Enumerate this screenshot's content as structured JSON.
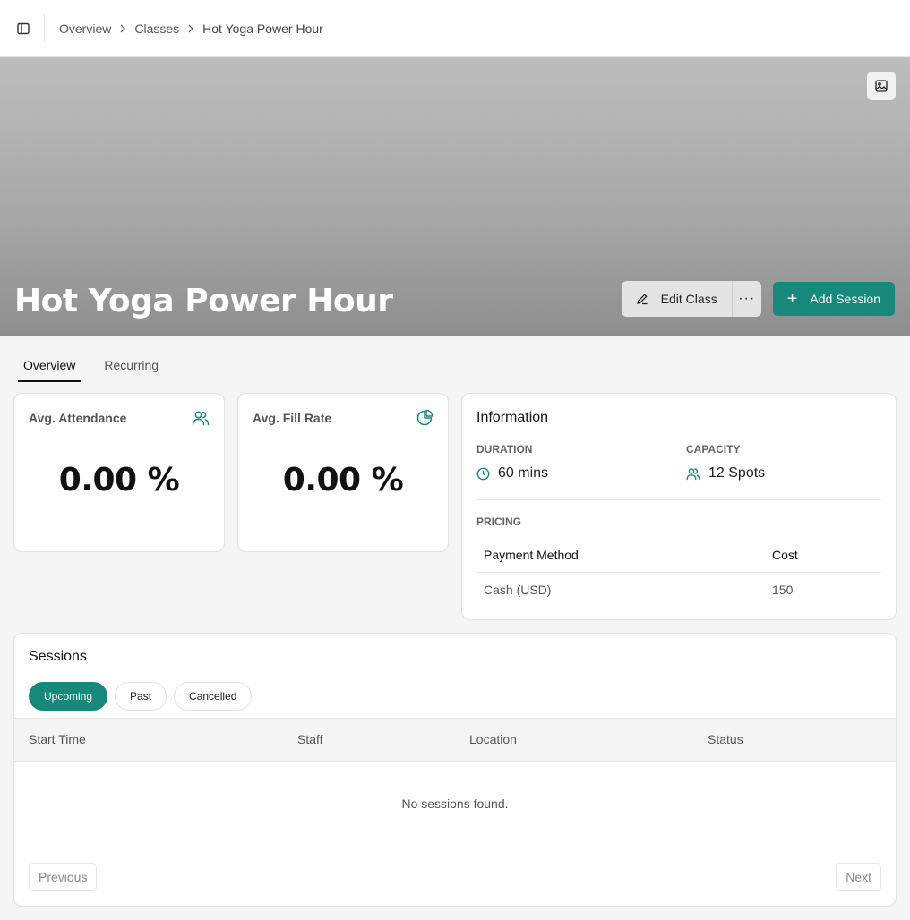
{
  "breadcrumb": {
    "items": [
      "Overview",
      "Classes"
    ],
    "current": "Hot Yoga Power Hour"
  },
  "hero": {
    "title": "Hot Yoga Power Hour",
    "edit_label": "Edit Class",
    "more_label": "···",
    "add_label": "Add Session",
    "add_icon": "+"
  },
  "tabs": [
    "Overview",
    "Recurring"
  ],
  "stats": {
    "attendance": {
      "label": "Avg. Attendance",
      "value": "0.00 %",
      "icon": "users-icon"
    },
    "fill_rate": {
      "label": "Avg. Fill Rate",
      "value": "0.00 %",
      "icon": "pie-chart-icon"
    }
  },
  "information": {
    "title": "Information",
    "duration_label": "DURATION",
    "duration_value": "60 mins",
    "capacity_label": "CAPACITY",
    "capacity_value": "12 Spots",
    "pricing_label": "PRICING",
    "pricing_headers": [
      "Payment Method",
      "Cost"
    ],
    "pricing_rows": [
      [
        "Cash (USD)",
        "150"
      ]
    ]
  },
  "sessions": {
    "title": "Sessions",
    "filters": [
      "Upcoming",
      "Past",
      "Cancelled"
    ],
    "columns": [
      "Start Time",
      "Staff",
      "Location",
      "Status"
    ],
    "empty_message": "No sessions found.",
    "prev_label": "Previous",
    "next_label": "Next"
  },
  "colors": {
    "accent": "#17897a"
  }
}
